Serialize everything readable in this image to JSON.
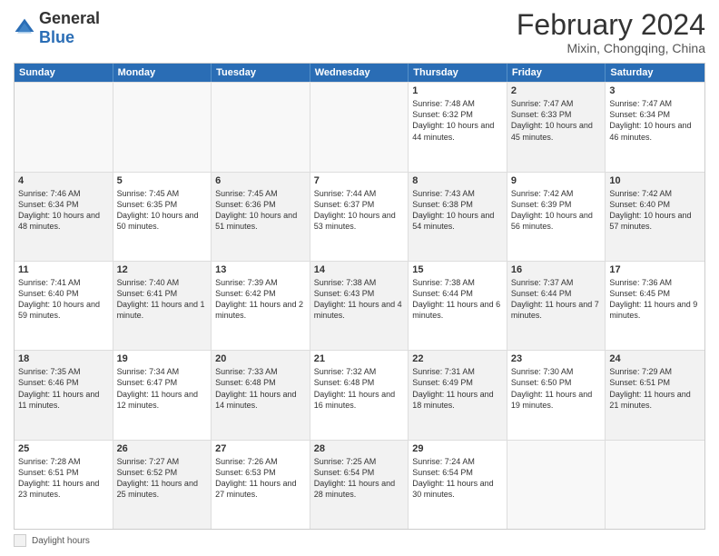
{
  "header": {
    "logo_general": "General",
    "logo_blue": "Blue",
    "month_title": "February 2024",
    "location": "Mixin, Chongqing, China"
  },
  "days_of_week": [
    "Sunday",
    "Monday",
    "Tuesday",
    "Wednesday",
    "Thursday",
    "Friday",
    "Saturday"
  ],
  "legend": {
    "label": "Daylight hours"
  },
  "weeks": [
    [
      {
        "day": "",
        "empty": true
      },
      {
        "day": "",
        "empty": true
      },
      {
        "day": "",
        "empty": true
      },
      {
        "day": "",
        "empty": true
      },
      {
        "day": "1",
        "sunrise": "Sunrise: 7:48 AM",
        "sunset": "Sunset: 6:32 PM",
        "daylight": "Daylight: 10 hours and 44 minutes.",
        "shaded": false
      },
      {
        "day": "2",
        "sunrise": "Sunrise: 7:47 AM",
        "sunset": "Sunset: 6:33 PM",
        "daylight": "Daylight: 10 hours and 45 minutes.",
        "shaded": true
      },
      {
        "day": "3",
        "sunrise": "Sunrise: 7:47 AM",
        "sunset": "Sunset: 6:34 PM",
        "daylight": "Daylight: 10 hours and 46 minutes.",
        "shaded": false
      }
    ],
    [
      {
        "day": "4",
        "sunrise": "Sunrise: 7:46 AM",
        "sunset": "Sunset: 6:34 PM",
        "daylight": "Daylight: 10 hours and 48 minutes.",
        "shaded": true
      },
      {
        "day": "5",
        "sunrise": "Sunrise: 7:45 AM",
        "sunset": "Sunset: 6:35 PM",
        "daylight": "Daylight: 10 hours and 50 minutes.",
        "shaded": false
      },
      {
        "day": "6",
        "sunrise": "Sunrise: 7:45 AM",
        "sunset": "Sunset: 6:36 PM",
        "daylight": "Daylight: 10 hours and 51 minutes.",
        "shaded": true
      },
      {
        "day": "7",
        "sunrise": "Sunrise: 7:44 AM",
        "sunset": "Sunset: 6:37 PM",
        "daylight": "Daylight: 10 hours and 53 minutes.",
        "shaded": false
      },
      {
        "day": "8",
        "sunrise": "Sunrise: 7:43 AM",
        "sunset": "Sunset: 6:38 PM",
        "daylight": "Daylight: 10 hours and 54 minutes.",
        "shaded": true
      },
      {
        "day": "9",
        "sunrise": "Sunrise: 7:42 AM",
        "sunset": "Sunset: 6:39 PM",
        "daylight": "Daylight: 10 hours and 56 minutes.",
        "shaded": false
      },
      {
        "day": "10",
        "sunrise": "Sunrise: 7:42 AM",
        "sunset": "Sunset: 6:40 PM",
        "daylight": "Daylight: 10 hours and 57 minutes.",
        "shaded": true
      }
    ],
    [
      {
        "day": "11",
        "sunrise": "Sunrise: 7:41 AM",
        "sunset": "Sunset: 6:40 PM",
        "daylight": "Daylight: 10 hours and 59 minutes.",
        "shaded": false
      },
      {
        "day": "12",
        "sunrise": "Sunrise: 7:40 AM",
        "sunset": "Sunset: 6:41 PM",
        "daylight": "Daylight: 11 hours and 1 minute.",
        "shaded": true
      },
      {
        "day": "13",
        "sunrise": "Sunrise: 7:39 AM",
        "sunset": "Sunset: 6:42 PM",
        "daylight": "Daylight: 11 hours and 2 minutes.",
        "shaded": false
      },
      {
        "day": "14",
        "sunrise": "Sunrise: 7:38 AM",
        "sunset": "Sunset: 6:43 PM",
        "daylight": "Daylight: 11 hours and 4 minutes.",
        "shaded": true
      },
      {
        "day": "15",
        "sunrise": "Sunrise: 7:38 AM",
        "sunset": "Sunset: 6:44 PM",
        "daylight": "Daylight: 11 hours and 6 minutes.",
        "shaded": false
      },
      {
        "day": "16",
        "sunrise": "Sunrise: 7:37 AM",
        "sunset": "Sunset: 6:44 PM",
        "daylight": "Daylight: 11 hours and 7 minutes.",
        "shaded": true
      },
      {
        "day": "17",
        "sunrise": "Sunrise: 7:36 AM",
        "sunset": "Sunset: 6:45 PM",
        "daylight": "Daylight: 11 hours and 9 minutes.",
        "shaded": false
      }
    ],
    [
      {
        "day": "18",
        "sunrise": "Sunrise: 7:35 AM",
        "sunset": "Sunset: 6:46 PM",
        "daylight": "Daylight: 11 hours and 11 minutes.",
        "shaded": true
      },
      {
        "day": "19",
        "sunrise": "Sunrise: 7:34 AM",
        "sunset": "Sunset: 6:47 PM",
        "daylight": "Daylight: 11 hours and 12 minutes.",
        "shaded": false
      },
      {
        "day": "20",
        "sunrise": "Sunrise: 7:33 AM",
        "sunset": "Sunset: 6:48 PM",
        "daylight": "Daylight: 11 hours and 14 minutes.",
        "shaded": true
      },
      {
        "day": "21",
        "sunrise": "Sunrise: 7:32 AM",
        "sunset": "Sunset: 6:48 PM",
        "daylight": "Daylight: 11 hours and 16 minutes.",
        "shaded": false
      },
      {
        "day": "22",
        "sunrise": "Sunrise: 7:31 AM",
        "sunset": "Sunset: 6:49 PM",
        "daylight": "Daylight: 11 hours and 18 minutes.",
        "shaded": true
      },
      {
        "day": "23",
        "sunrise": "Sunrise: 7:30 AM",
        "sunset": "Sunset: 6:50 PM",
        "daylight": "Daylight: 11 hours and 19 minutes.",
        "shaded": false
      },
      {
        "day": "24",
        "sunrise": "Sunrise: 7:29 AM",
        "sunset": "Sunset: 6:51 PM",
        "daylight": "Daylight: 11 hours and 21 minutes.",
        "shaded": true
      }
    ],
    [
      {
        "day": "25",
        "sunrise": "Sunrise: 7:28 AM",
        "sunset": "Sunset: 6:51 PM",
        "daylight": "Daylight: 11 hours and 23 minutes.",
        "shaded": false
      },
      {
        "day": "26",
        "sunrise": "Sunrise: 7:27 AM",
        "sunset": "Sunset: 6:52 PM",
        "daylight": "Daylight: 11 hours and 25 minutes.",
        "shaded": true
      },
      {
        "day": "27",
        "sunrise": "Sunrise: 7:26 AM",
        "sunset": "Sunset: 6:53 PM",
        "daylight": "Daylight: 11 hours and 27 minutes.",
        "shaded": false
      },
      {
        "day": "28",
        "sunrise": "Sunrise: 7:25 AM",
        "sunset": "Sunset: 6:54 PM",
        "daylight": "Daylight: 11 hours and 28 minutes.",
        "shaded": true
      },
      {
        "day": "29",
        "sunrise": "Sunrise: 7:24 AM",
        "sunset": "Sunset: 6:54 PM",
        "daylight": "Daylight: 11 hours and 30 minutes.",
        "shaded": false
      },
      {
        "day": "",
        "empty": true
      },
      {
        "day": "",
        "empty": true
      }
    ]
  ]
}
